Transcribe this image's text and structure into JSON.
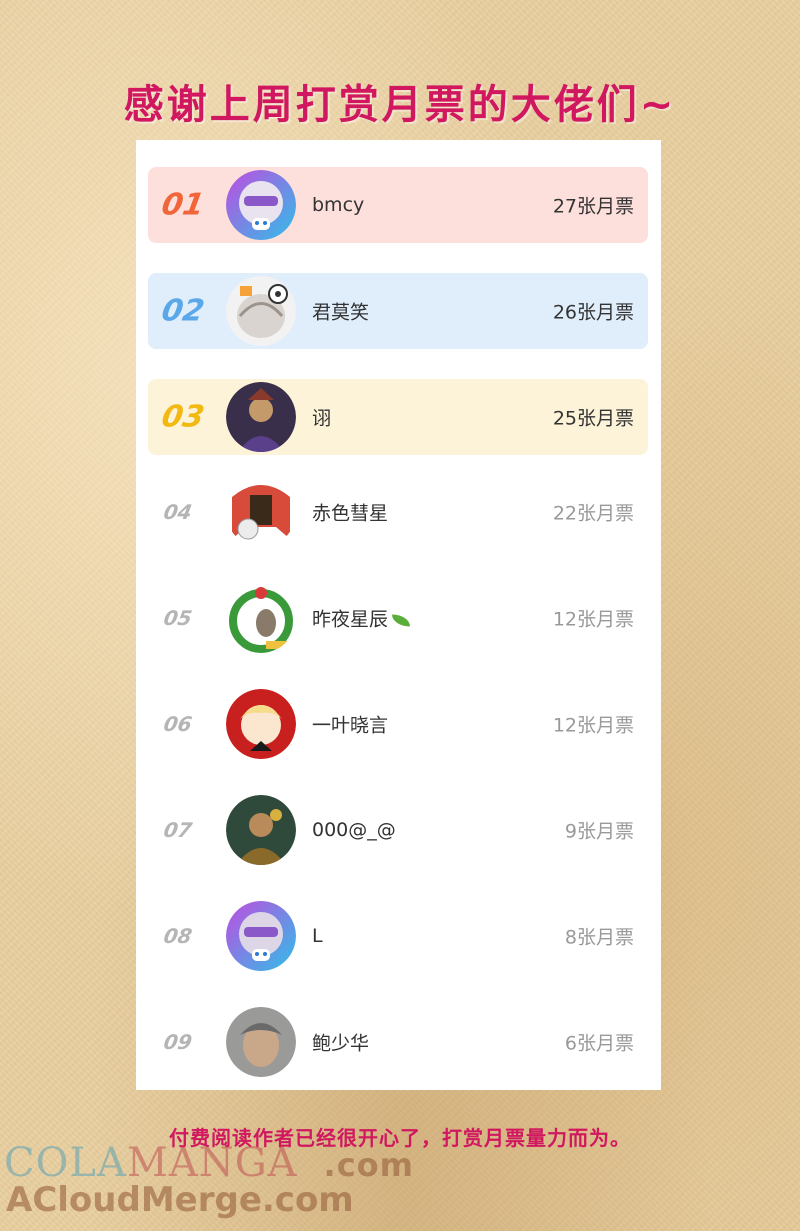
{
  "title": "感谢上周打赏月票的大佬们~",
  "leaderboard": [
    {
      "rank": "01",
      "name": "bmcy",
      "votes": "27张月票"
    },
    {
      "rank": "02",
      "name": "君莫笑",
      "votes": "26张月票"
    },
    {
      "rank": "03",
      "name": "诩",
      "votes": "25张月票"
    },
    {
      "rank": "04",
      "name": "赤色彗星",
      "votes": "22张月票"
    },
    {
      "rank": "05",
      "name": "昨夜星辰",
      "votes": "12张月票",
      "name_icon": "leaf-icon"
    },
    {
      "rank": "06",
      "name": "一叶晓言",
      "votes": "12张月票"
    },
    {
      "rank": "07",
      "name": "000@_@",
      "votes": "9张月票"
    },
    {
      "rank": "08",
      "name": "L",
      "votes": "8张月票"
    },
    {
      "rank": "09",
      "name": "鲍少华",
      "votes": "6张月票"
    }
  ],
  "footer_note": "付费阅读作者已经很开心了，打赏月票量力而为。",
  "watermark": {
    "line1_a": "COLA",
    "line1_b": "MANGA",
    "line1_c": ".com",
    "line2": "ACloudMerge.com"
  },
  "colors": {
    "title": "#d0175f",
    "rank1": "#f0663a",
    "rank2": "#5aa8ea",
    "rank3": "#f3b913",
    "rank1_bg": "#fde0dc",
    "rank2_bg": "#e0eefc",
    "rank3_bg": "#fdf3d8"
  }
}
